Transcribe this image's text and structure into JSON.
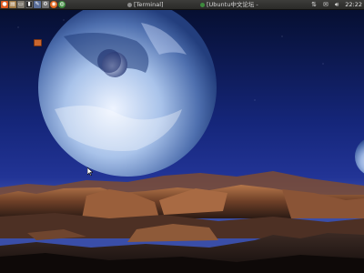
{
  "panel": {
    "launchers": [
      {
        "icon": "ubuntu-icon",
        "color": "#e05a1f",
        "glyph": "●"
      },
      {
        "icon": "files-icon",
        "color": "#a07a45",
        "glyph": "▤"
      },
      {
        "icon": "home-folder-icon",
        "color": "#7f7a70",
        "glyph": "▭"
      },
      {
        "icon": "terminal-icon",
        "color": "#222222",
        "glyph": "▮"
      },
      {
        "icon": "editor-icon",
        "color": "#5b6f9a",
        "glyph": "✎"
      },
      {
        "icon": "settings-icon",
        "color": "#6f6f6f",
        "glyph": "⚙"
      },
      {
        "icon": "firefox-icon",
        "color": "#e0651c",
        "glyph": "◉"
      },
      {
        "icon": "chrome-icon",
        "color": "#3d8b3d",
        "glyph": "◍"
      }
    ],
    "tasks": [
      {
        "label": "[Terminal]"
      },
      {
        "label": "[Ubuntu中文论坛 -"
      }
    ],
    "tray": {
      "network_icon": "network-icon",
      "mail_icon": "mail-icon",
      "volume_icon": "volume-icon"
    },
    "clock": "22:22"
  },
  "desktop": {
    "icon": "desktop-folder-icon"
  }
}
